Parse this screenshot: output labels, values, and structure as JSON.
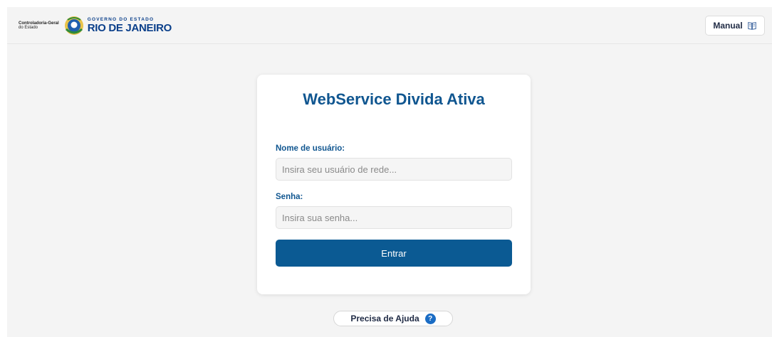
{
  "header": {
    "cge_line1": "Controladoria-Geral",
    "cge_line2": "do Estado",
    "rj_line1": "GOVERNO DO ESTADO",
    "rj_line2": "RIO DE JANEIRO",
    "manual_label": "Manual",
    "manual_icon": "book-icon",
    "crest_icon": "state-crest-icon"
  },
  "login": {
    "title": "WebService Divida Ativa",
    "username_label": "Nome de usuário:",
    "username_placeholder": "Insira seu usuário de rede...",
    "username_value": "",
    "password_label": "Senha:",
    "password_placeholder": "Insira sua senha...",
    "password_value": "",
    "submit_label": "Entrar"
  },
  "help": {
    "label": "Precisa de Ajuda",
    "icon_glyph": "?",
    "icon": "question-circle-icon"
  },
  "colors": {
    "primary": "#0b5a93",
    "title": "#105690",
    "background": "#f4f4f4",
    "help_icon": "#1a6cc4"
  }
}
